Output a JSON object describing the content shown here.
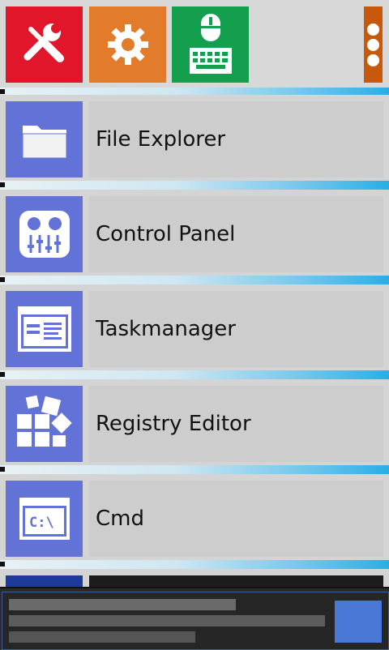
{
  "toolbar": {
    "tools_label": "Tools",
    "settings_label": "Settings",
    "input_label": "Mouse and keyboard",
    "more_label": "More options"
  },
  "list": {
    "items": [
      {
        "label": "File Explorer",
        "icon": "folder-icon"
      },
      {
        "label": "Control Panel",
        "icon": "control-panel-icon"
      },
      {
        "label": "Taskmanager",
        "icon": "taskmanager-icon"
      },
      {
        "label": "Registry Editor",
        "icon": "registry-icon"
      },
      {
        "label": "Cmd",
        "icon": "cmd-icon"
      }
    ]
  },
  "colors": {
    "tools_tile": "#e2162b",
    "settings_tile": "#e27c2a",
    "input_tile": "#149f4e",
    "more_tile": "#c7580c",
    "item_icon_tile": "#6272d6"
  }
}
